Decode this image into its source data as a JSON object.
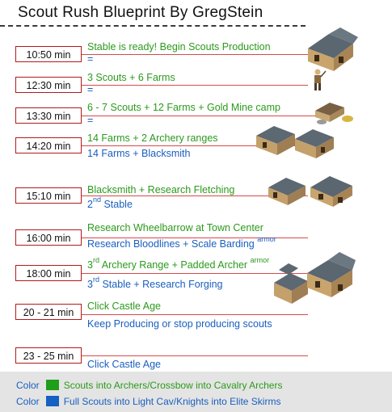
{
  "title": "Scout Rush Blueprint By GregStein",
  "rows": [
    {
      "time": "10:50 min",
      "green": "Stable is ready! Begin Scouts Production",
      "blue": "="
    },
    {
      "time": "12:30 min",
      "green": "3 Scouts + 6 Farms",
      "blue": "="
    },
    {
      "time": "13:30 min",
      "green": "6 - 7 Scouts + 12 Farms + Gold Mine camp",
      "blue": "="
    },
    {
      "time": "14:20 min",
      "green": "14 Farms + 2 Archery ranges",
      "blue": "14 Farms + Blacksmith"
    },
    {
      "time": "15:10 min",
      "green": "Blacksmith + Research Fletching",
      "blue_sup": "nd",
      "blue_num": "2",
      "blue": "Stable"
    },
    {
      "time": "16:00 min",
      "green": "Research Wheelbarrow at Town Center",
      "blue": "Research Bloodlines + Scale Barding",
      "blue_sup": "armor"
    },
    {
      "time": "18:00 min",
      "green_num": "3",
      "green_sup": "rd",
      "green": "Archery Range + Padded Archer",
      "green_sup2": "armor",
      "blue_num": "3",
      "blue_sup": "rd",
      "blue": "Stable + Research Forging"
    },
    {
      "time": "20 - 21 min",
      "green": "Click Castle Age",
      "blue": "Keep Producing or stop producing scouts"
    },
    {
      "time": "23 - 25 min",
      "blue": "Click Castle Age"
    }
  ],
  "legend": [
    {
      "label": "Color",
      "color": "#1f9e1a",
      "text": "Scouts into Archers/Crossbow into Cavalry Archers"
    },
    {
      "label": "Color",
      "color": "#1560c0",
      "text": "Full Scouts into Light Cav/Knights into Elite Skirms"
    }
  ],
  "icons": [
    "stable-building-icon",
    "villager-unit-icon",
    "mining-camp-icon",
    "archery-range-icon",
    "blacksmith-building-icon"
  ]
}
